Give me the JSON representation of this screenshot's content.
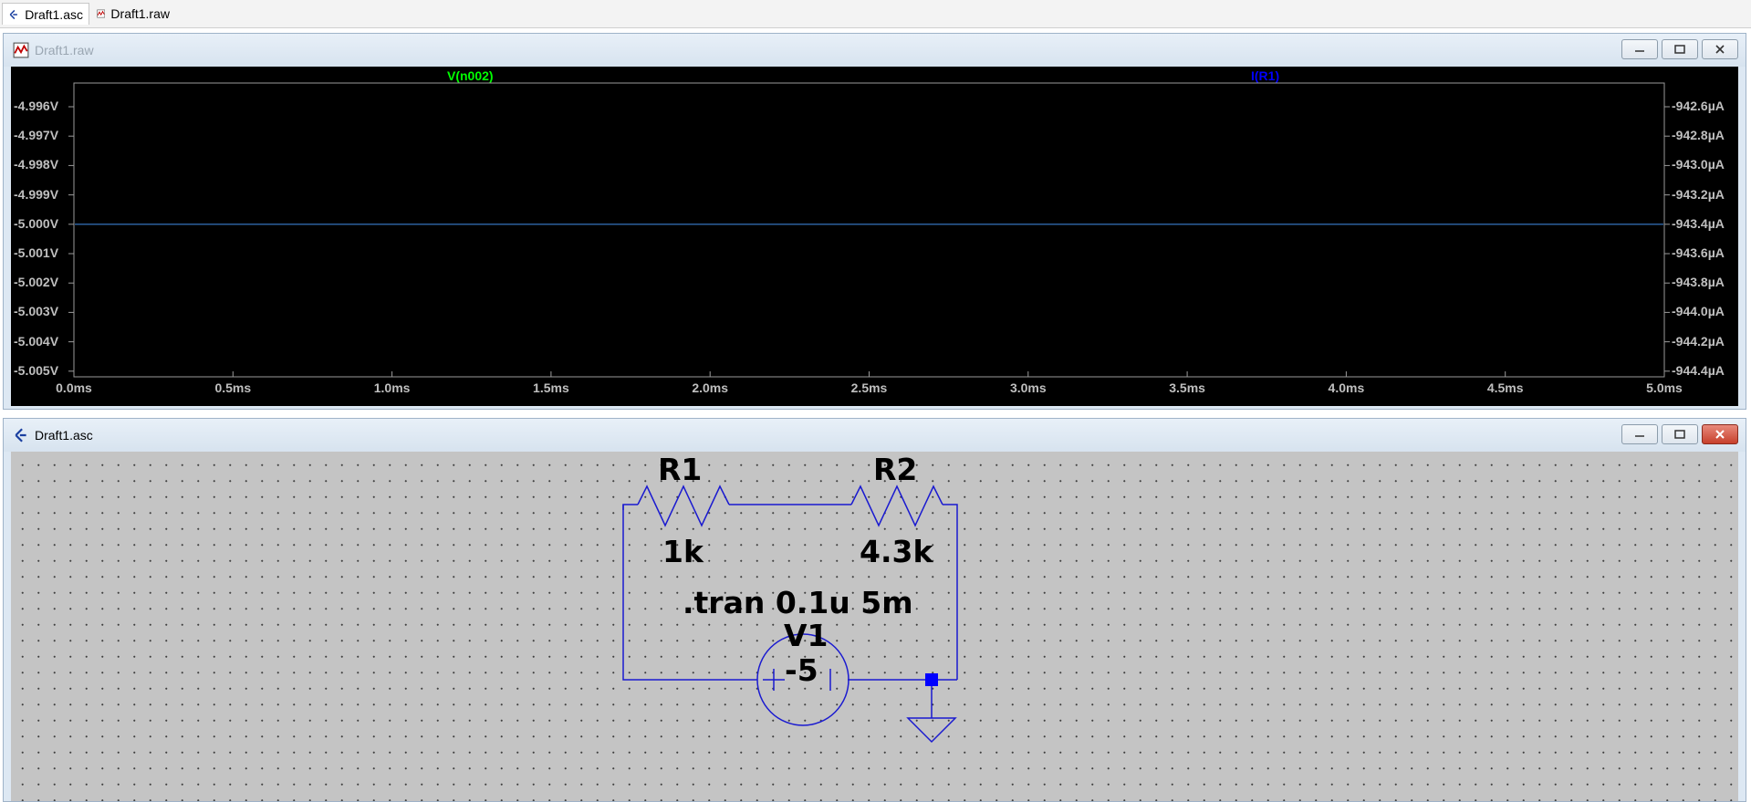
{
  "tabs": [
    {
      "label": "Draft1.asc",
      "icon": "schematic-icon"
    },
    {
      "label": "Draft1.raw",
      "icon": "waveform-icon"
    }
  ],
  "waveform_window": {
    "title": "Draft1.raw",
    "icon": "waveform-icon",
    "traces": [
      {
        "name": "V(n002)",
        "color": "#00ff00"
      },
      {
        "name": "I(R1)",
        "color": "#0000ff"
      }
    ],
    "left_axis_ticks": [
      "-4.996V",
      "-4.997V",
      "-4.998V",
      "-4.999V",
      "-5.000V",
      "-5.001V",
      "-5.002V",
      "-5.003V",
      "-5.004V",
      "-5.005V"
    ],
    "right_axis_ticks": [
      "-942.6µA",
      "-942.8µA",
      "-943.0µA",
      "-943.2µA",
      "-943.4µA",
      "-943.6µA",
      "-943.8µA",
      "-944.0µA",
      "-944.2µA",
      "-944.4µA"
    ],
    "x_axis_ticks": [
      "0.0ms",
      "0.5ms",
      "1.0ms",
      "1.5ms",
      "2.0ms",
      "2.5ms",
      "3.0ms",
      "3.5ms",
      "4.0ms",
      "4.5ms",
      "5.0ms"
    ],
    "trace_line_color": "#3a7fd0"
  },
  "schematic_window": {
    "title": "Draft1.asc",
    "icon": "schematic-icon",
    "components": {
      "r1_name": "R1",
      "r1_value": "1k",
      "r2_name": "R2",
      "r2_value": "4.3k",
      "v1_name": "V1",
      "v1_value": "-5",
      "directive": ".tran 0.1u 5m"
    },
    "wire_color": "#1a1ad0",
    "junction_color": "#0000ff"
  },
  "chart_data": {
    "type": "line",
    "x": [
      0.0,
      5.0
    ],
    "xlabel": "",
    "ylabel": "",
    "xlim": [
      0.0,
      5.0
    ],
    "ylim": [
      -5.005,
      -4.996
    ],
    "y2lim": [
      -944.4,
      -942.6
    ],
    "series": [
      {
        "name": "V(n002)",
        "values": [
          -5.0,
          -5.0
        ]
      },
      {
        "name": "I(R1)",
        "values": [
          -943.4,
          -943.4
        ]
      }
    ],
    "grid": false,
    "legend": "top"
  }
}
